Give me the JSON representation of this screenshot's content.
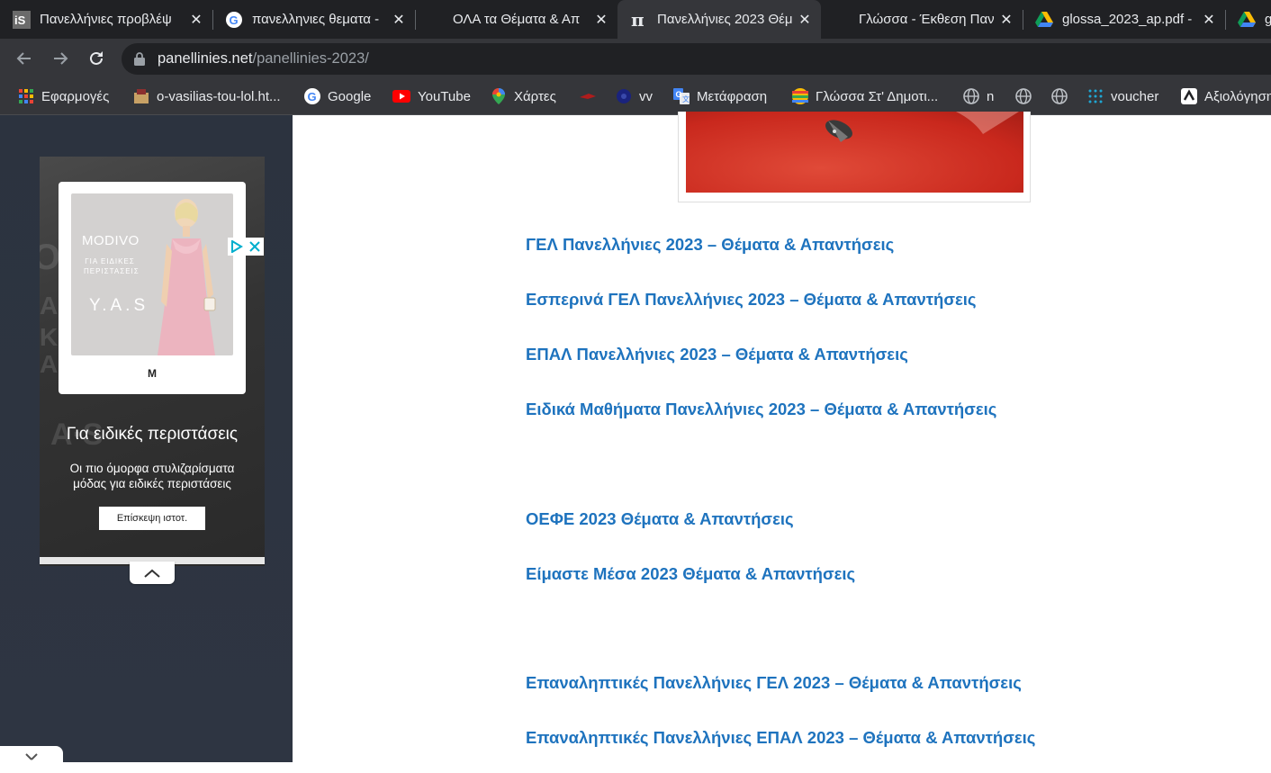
{
  "browser": {
    "tabs": [
      {
        "title": "Πανελλήνιες προβλέψ",
        "favicon": "is-logo-icon",
        "active": false
      },
      {
        "title": "πανελληνιες θεματα -",
        "favicon": "google-icon",
        "active": false
      },
      {
        "title": "ΟΛΑ τα Θέματα & Απ",
        "favicon": "none",
        "active": false
      },
      {
        "title": "Πανελλήνιες 2023 Θέμ",
        "favicon": "pi-icon",
        "active": true
      },
      {
        "title": "Γλώσσα - Έκθεση Παν",
        "favicon": "none",
        "active": false
      },
      {
        "title": "glossa_2023_ap.pdf -",
        "favicon": "google-drive-icon",
        "active": false
      },
      {
        "title": "g",
        "favicon": "google-drive-icon",
        "active": false
      }
    ],
    "url_domain": "panellinies.net",
    "url_path": "/panellinies-2023/",
    "bookmarks": [
      {
        "label": "Εφαρμογές",
        "icon": "apps-grid-icon"
      },
      {
        "label": "o-vasilias-tou-lol.ht...",
        "icon": "site-icon"
      },
      {
        "label": "Google",
        "icon": "google-icon"
      },
      {
        "label": "YouTube",
        "icon": "youtube-icon"
      },
      {
        "label": "Χάρτες",
        "icon": "maps-pin-icon"
      },
      {
        "label": "",
        "icon": "red-bookmark-icon"
      },
      {
        "label": "vv",
        "icon": "dark-circle-icon"
      },
      {
        "label": "Μετάφραση",
        "icon": "translate-icon"
      },
      {
        "label": "Γλώσσα Στ' Δημοτι...",
        "icon": "colorful-ball-icon"
      },
      {
        "label": "n",
        "icon": "globe-icon"
      },
      {
        "label": "",
        "icon": "globe-icon"
      },
      {
        "label": "",
        "icon": "globe-icon"
      },
      {
        "label": "voucher",
        "icon": "dotted-grid-icon"
      },
      {
        "label": "Αξιολόγηση",
        "icon": "review-icon"
      }
    ]
  },
  "ad": {
    "brand": "MODIVO",
    "subtitle": "ΓΙΑ ΕΙΔΙΚΕΣ ΠΕΡΙΣΤΑΣΕΙΣ",
    "yas": "Y.A.S",
    "logo": "M",
    "headline": "Για ειδικές περιστάσεις",
    "description": "Οι πιο όμορφα στυλιζαρίσματα μόδας για ειδικές περιστάσεις",
    "cta": "Επίσκεψη ιστοτ."
  },
  "links": [
    "ΓΕΛ Πανελλήνιες 2023 – Θέματα & Απαντήσεις",
    "Εσπερινά ΓΕΛ Πανελλήνιες 2023 – Θέματα & Απαντήσεις",
    "ΕΠΑΛ Πανελλήνιες 2023 – Θέματα & Απαντήσεις",
    "Ειδικά Μαθήματα Πανελλήνιες 2023 – Θέματα & Απαντήσεις",
    "ΟΕΦΕ 2023 Θέματα & Απαντήσεις",
    "Είμαστε Μέσα 2023 Θέματα & Απαντήσεις",
    "Επαναληπτικές Πανελλήνιες ΓΕΛ 2023 – Θέματα & Απαντήσεις",
    "Επαναληπτικές Πανελλήνιες ΕΠΑΛ 2023 – Θέματα & Απαντήσεις"
  ],
  "colors": {
    "link": "#1e73be",
    "tabstrip": "#202124",
    "toolbar": "#35363a",
    "sidebar": "#2d3440"
  }
}
